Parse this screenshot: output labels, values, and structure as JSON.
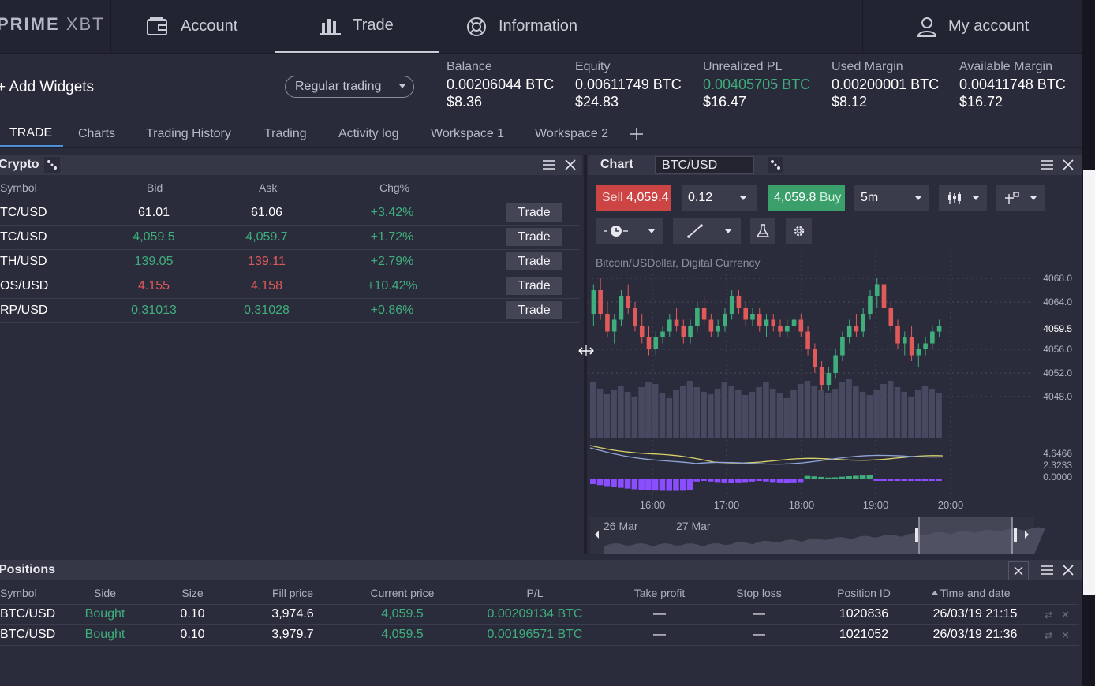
{
  "nav": {
    "logo_a": "PRIME",
    "logo_b": "XBT",
    "account": "Account",
    "trade": "Trade",
    "information": "Information",
    "my_account": "My account"
  },
  "accbar": {
    "add_widgets": "Add Widgets",
    "mode": "Regular trading",
    "stats": [
      {
        "label": "Balance",
        "btc": "0.00206044 BTC",
        "usd": "$8.36"
      },
      {
        "label": "Equity",
        "btc": "0.00611749 BTC",
        "usd": "$24.83"
      },
      {
        "label": "Unrealized PL",
        "btc": "0.00405705 BTC",
        "usd": "$16.47"
      },
      {
        "label": "Used Margin",
        "btc": "0.00200001 BTC",
        "usd": "$8.12"
      },
      {
        "label": "Available Margin",
        "btc": "0.00411748 BTC",
        "usd": "$16.72"
      }
    ]
  },
  "tabs": [
    "TRADE",
    "Charts",
    "Trading History",
    "Trading",
    "Activity log",
    "Workspace 1",
    "Workspace 2"
  ],
  "crypto": {
    "title": "Crypto",
    "headers": [
      "Symbol",
      "Bid",
      "Ask",
      "Chg%"
    ],
    "trade_label": "Trade",
    "rows": [
      {
        "symbol": "TC/USD",
        "bid": "61.01",
        "ask": "61.06",
        "chg": "+3.42%",
        "bidc": "#ffffff",
        "askc": "#ffffff"
      },
      {
        "symbol": "TC/USD",
        "bid": "4,059.5",
        "ask": "4,059.7",
        "chg": "+1.72%",
        "bidc": "#3fae7c",
        "askc": "#3fae7c"
      },
      {
        "symbol": "TH/USD",
        "bid": "139.05",
        "ask": "139.11",
        "chg": "+2.79%",
        "bidc": "#3fae7c",
        "askc": "#e05a5a"
      },
      {
        "symbol": "OS/USD",
        "bid": "4.155",
        "ask": "4.158",
        "chg": "+10.42%",
        "bidc": "#e05a5a",
        "askc": "#e05a5a"
      },
      {
        "symbol": "RP/USD",
        "bid": "0.31013",
        "ask": "0.31028",
        "chg": "+0.86%",
        "bidc": "#3fae7c",
        "askc": "#3fae7c"
      }
    ]
  },
  "chart": {
    "title": "Chart",
    "symbol": "BTC/USD",
    "sell_label": "Sell",
    "sell_price": "4,059.4",
    "qty": "0.12",
    "buy_price": "4,059.8",
    "buy_label": "Buy",
    "interval": "5m",
    "series_label": "Bitcoin/USDollar, Digital Currency",
    "price_axis": [
      "4068.0",
      "4064.0",
      "4059.5",
      "4056.0",
      "4052.0",
      "4048.0"
    ],
    "osc_axis": [
      "4.6466",
      "2.3233",
      "0.0000"
    ],
    "times": [
      "16:00",
      "17:00",
      "18:00",
      "19:00",
      "20:00"
    ],
    "nav_dates": [
      "26 Mar",
      "27 Mar"
    ],
    "colors": {
      "up": "#3fae7c",
      "down": "#e05a5a",
      "volume": "#4a4d66"
    }
  },
  "chart_data": {
    "type": "candlestick",
    "title": "Bitcoin/USDollar, Digital Currency",
    "x": [
      "16:00",
      "17:00",
      "18:00",
      "19:00",
      "20:00"
    ],
    "ylim": [
      4046,
      4070
    ],
    "candles": [
      [
        4062,
        4067,
        4060,
        4066
      ],
      [
        4066,
        4068,
        4061,
        4062
      ],
      [
        4062,
        4064,
        4058,
        4059
      ],
      [
        4059,
        4062,
        4057,
        4061
      ],
      [
        4061,
        4066,
        4060,
        4065
      ],
      [
        4065,
        4067,
        4062,
        4063
      ],
      [
        4063,
        4064,
        4059,
        4060
      ],
      [
        4060,
        4062,
        4057,
        4058
      ],
      [
        4058,
        4060,
        4055,
        4056
      ],
      [
        4056,
        4059,
        4055,
        4058
      ],
      [
        4058,
        4060,
        4057,
        4059
      ],
      [
        4059,
        4062,
        4058,
        4061
      ],
      [
        4061,
        4063,
        4059,
        4060
      ],
      [
        4060,
        4061,
        4057,
        4058
      ],
      [
        4058,
        4061,
        4057,
        4060
      ],
      [
        4060,
        4064,
        4059,
        4063
      ],
      [
        4063,
        4065,
        4060,
        4061
      ],
      [
        4061,
        4062,
        4058,
        4059
      ],
      [
        4059,
        4061,
        4058,
        4060
      ],
      [
        4060,
        4063,
        4059,
        4062
      ],
      [
        4062,
        4066,
        4061,
        4065
      ],
      [
        4065,
        4066,
        4062,
        4063
      ],
      [
        4063,
        4064,
        4060,
        4061
      ],
      [
        4061,
        4063,
        4060,
        4062
      ],
      [
        4062,
        4063,
        4059,
        4060
      ],
      [
        4060,
        4062,
        4058,
        4061
      ],
      [
        4061,
        4062,
        4059,
        4060
      ],
      [
        4060,
        4061,
        4058,
        4059
      ],
      [
        4059,
        4061,
        4058,
        4060
      ],
      [
        4060,
        4062,
        4059,
        4061
      ],
      [
        4061,
        4062,
        4058,
        4059
      ],
      [
        4059,
        4060,
        4055,
        4056
      ],
      [
        4056,
        4057,
        4052,
        4053
      ],
      [
        4053,
        4054,
        4049,
        4050
      ],
      [
        4050,
        4053,
        4049,
        4052
      ],
      [
        4052,
        4056,
        4051,
        4055
      ],
      [
        4055,
        4059,
        4054,
        4058
      ],
      [
        4058,
        4061,
        4057,
        4060
      ],
      [
        4060,
        4062,
        4058,
        4059
      ],
      [
        4059,
        4063,
        4058,
        4062
      ],
      [
        4062,
        4066,
        4061,
        4065
      ],
      [
        4065,
        4068,
        4063,
        4067
      ],
      [
        4067,
        4068,
        4062,
        4063
      ],
      [
        4063,
        4064,
        4059,
        4060
      ],
      [
        4060,
        4061,
        4056,
        4057
      ],
      [
        4057,
        4059,
        4055,
        4058
      ],
      [
        4058,
        4060,
        4054,
        4055
      ],
      [
        4055,
        4057,
        4053,
        4056
      ],
      [
        4056,
        4058,
        4055,
        4057
      ],
      [
        4057,
        4060,
        4056,
        4059
      ],
      [
        4059,
        4061,
        4058,
        4060
      ]
    ],
    "volume": [
      70,
      62,
      55,
      60,
      66,
      58,
      52,
      64,
      70,
      68,
      56,
      50,
      60,
      66,
      72,
      64,
      58,
      55,
      62,
      70,
      66,
      60,
      54,
      58,
      64,
      70,
      62,
      56,
      50,
      60,
      68,
      72,
      66,
      60,
      56,
      62,
      70,
      74,
      66,
      58,
      54,
      60,
      68,
      72,
      64,
      58,
      52,
      60,
      66,
      62,
      56
    ]
  },
  "positions": {
    "title": "Positions",
    "headers": [
      "Symbol",
      "Side",
      "Size",
      "Fill price",
      "Current price",
      "P/L",
      "Take profit",
      "Stop loss",
      "Position ID",
      "Time and date"
    ],
    "rows": [
      {
        "symbol": "BTC/USD",
        "side": "Bought",
        "size": "0.10",
        "fill": "3,974.6",
        "current": "4,059.5",
        "pl": "0.00209134 BTC",
        "tp": "—",
        "sl": "—",
        "id": "1020836",
        "time": "26/03/19 21:15"
      },
      {
        "symbol": "BTC/USD",
        "side": "Bought",
        "size": "0.10",
        "fill": "3,979.7",
        "current": "4,059.5",
        "pl": "0.00196571 BTC",
        "tp": "—",
        "sl": "—",
        "id": "1021052",
        "time": "26/03/19 21:36"
      }
    ]
  }
}
